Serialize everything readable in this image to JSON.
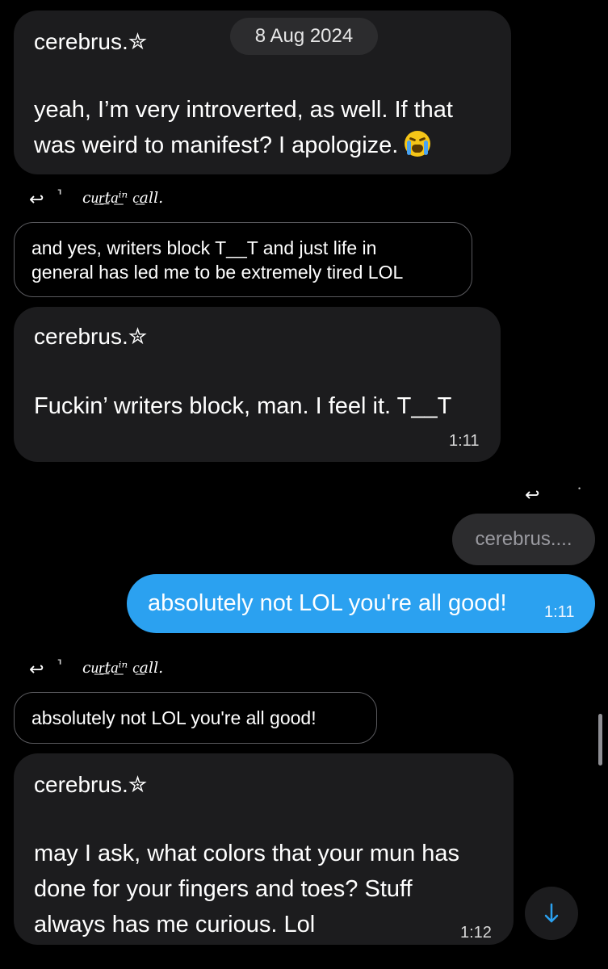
{
  "date_separator": "8 Aug 2024",
  "messages": [
    {
      "sender": "cerebrus.✮",
      "lines": [
        "yeah, I’m very introverted, as well. If that",
        "was weird to manifest? I apologize."
      ],
      "emoji": "loudly-crying-face-emoji"
    },
    {
      "sender": "cerebrus.✮",
      "lines": [
        "Fuckin’ writers block, man. I feel it. T__T"
      ],
      "time": "1:11"
    },
    {
      "sender": "cerebrus.✮",
      "lines": [
        "may I ask, what colors that your mun has",
        "done for your fingers and toes? Stuff",
        "always has me curious. Lol"
      ],
      "time": "1:12"
    }
  ],
  "replies": [
    {
      "replied_to": "cu͟r͟ta͟ⁱⁿ c͟all.",
      "quote_lines": [
        "and yes, writers block T__T and just life in",
        "general has led me to be extremely tired LOL"
      ]
    },
    {
      "replied_to": "cu͟r͟ta͟ⁱⁿ c͟all.",
      "quote_lines": [
        "absolutely not LOL you're all good!"
      ]
    }
  ],
  "outgoing": {
    "quote": "cerebrus....",
    "text": "absolutely not LOL you're all good!",
    "time": "1:11"
  },
  "icons": {
    "reply": "reply-arrow-icon",
    "feather": "feather-icon",
    "scroll_down": "arrow-down-icon"
  },
  "colors": {
    "background": "#000000",
    "incoming_bubble": "#1c1c1e",
    "outgoing_bubble": "#2ba1f0",
    "accent": "#2ba1f0"
  }
}
